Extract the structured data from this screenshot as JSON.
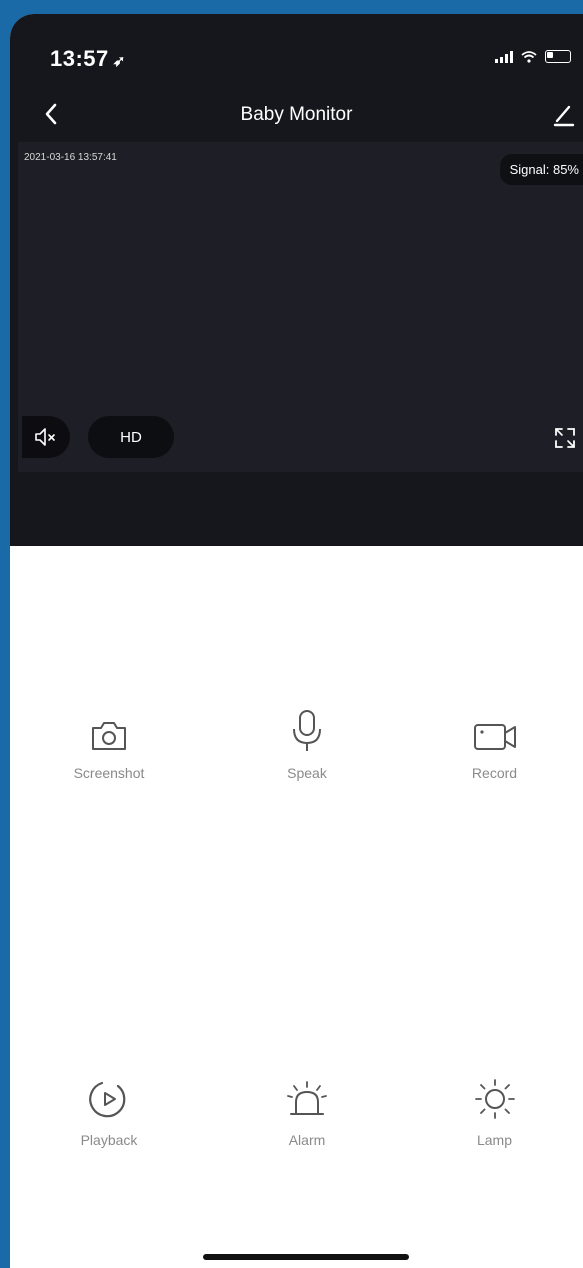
{
  "status_bar": {
    "time": "13:57",
    "location_glyph": "➶"
  },
  "header": {
    "title": "Baby Monitor"
  },
  "video": {
    "timestamp": "2021-03-16 13:57:41",
    "signal_label": "Signal: 85%",
    "quality": "HD"
  },
  "actions": [
    {
      "label": "Screenshot",
      "icon": "camera-icon"
    },
    {
      "label": "Speak",
      "icon": "microphone-icon"
    },
    {
      "label": "Record",
      "icon": "video-camera-icon"
    },
    {
      "label": "Playback",
      "icon": "playback-icon"
    },
    {
      "label": "Alarm",
      "icon": "siren-icon"
    },
    {
      "label": "Lamp",
      "icon": "sun-icon"
    }
  ],
  "colors": {
    "background_blue": "#1a6aa8",
    "dark_panel": "#15171d",
    "label_gray": "#8a8a8a"
  }
}
